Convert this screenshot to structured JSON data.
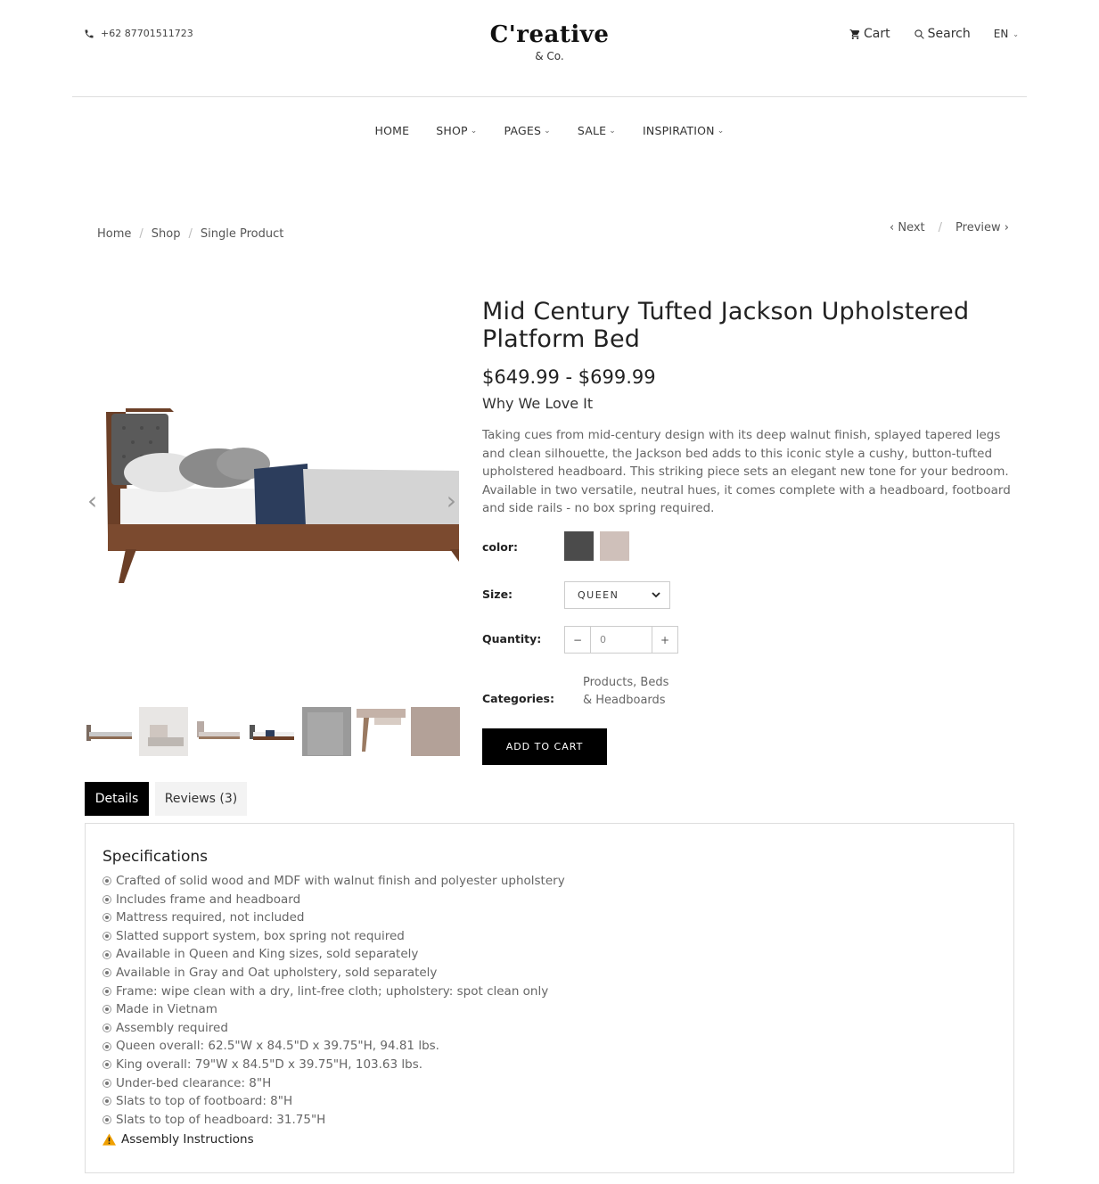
{
  "header": {
    "phone": "+62 87701511723",
    "logo_main": "C'reative",
    "logo_sub": "& Co.",
    "cart_label": "Cart",
    "search_label": "Search",
    "language": "EN"
  },
  "nav": {
    "items": [
      "HOME",
      "SHOP",
      "PAGES",
      "SALE",
      "INSPIRATION"
    ]
  },
  "breadcrumb": {
    "items": [
      "Home",
      "Shop",
      "Single Product"
    ]
  },
  "pager": {
    "next_label": "Next",
    "preview_label": "Preview"
  },
  "product": {
    "title": "Mid Century Tufted Jackson Upholstered Platform Bed",
    "price": "$649.99 - $699.99",
    "subtitle": "Why We Love It",
    "description": "Taking cues from mid-century design with its deep walnut finish, splayed tapered legs and clean silhouette, the Jackson bed adds to this iconic style a cushy, button-tufted upholstered headboard. This striking piece sets an elegant new tone for your bedroom. Available in two versatile, neutral hues, it comes complete with a headboard, footboard and side rails - no box spring required.",
    "color_label": "color:",
    "colors": [
      "#4b4b4b",
      "#cfc0ba"
    ],
    "size_label": "Size:",
    "size_value": "QUEEN",
    "quantity_label": "Quantity:",
    "quantity_value": "0",
    "categories_label": "Categories:",
    "categories_value": "Products, Beds & Headboards",
    "add_to_cart": "ADD TO CART"
  },
  "tabs": {
    "details": "Details",
    "reviews": "Reviews (3)"
  },
  "specs": {
    "title": "Specifications",
    "items": [
      "Crafted of solid wood and MDF with walnut finish and polyester upholstery",
      "Includes frame and headboard",
      "Mattress required, not included",
      "Slatted support system, box spring not required",
      "Available in Queen and King sizes, sold separately",
      "Available in Gray and Oat upholstery, sold separately",
      "Frame: wipe clean with a dry, lint-free cloth; upholstery: spot clean only",
      "Made in Vietnam",
      "Assembly required",
      "Queen overall: 62.5\"W x 84.5\"D x 39.75\"H, 94.81 lbs.",
      "King overall: 79\"W x 84.5\"D x 39.75\"H, 103.63 lbs.",
      "Under-bed clearance: 8\"H",
      "Slats to top of footboard: 8\"H",
      "Slats to top of headboard: 31.75\"H"
    ],
    "assembly_label": "Assembly Instructions"
  }
}
